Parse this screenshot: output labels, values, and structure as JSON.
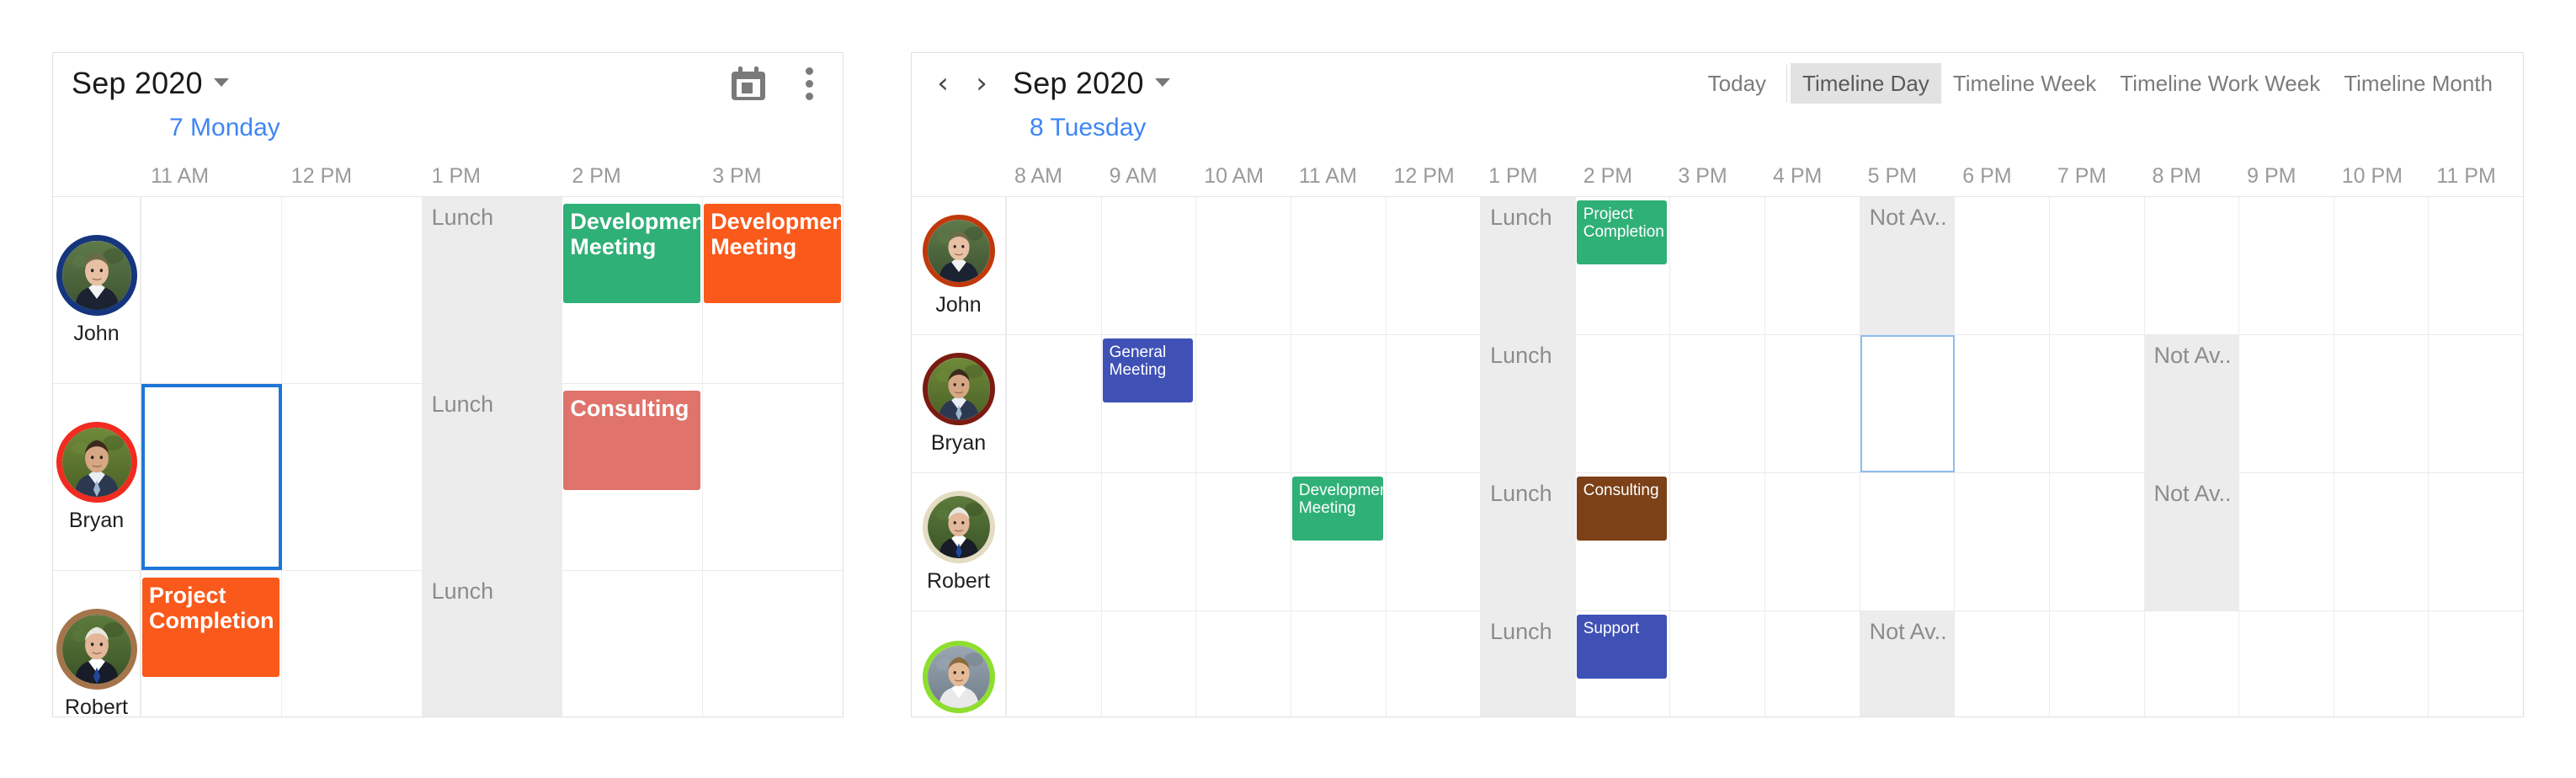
{
  "colors": {
    "accent_blue": "#3f86f4",
    "selection_strong": "#1e76d6",
    "selection_light": "#8ebdf0",
    "green": "#2fb077",
    "orange": "#f9591b",
    "salmon": "#e0736b",
    "indigo": "#3f51b5",
    "brown": "#7c4117",
    "nonworking_gray": "#ececec",
    "grid_line": "#eaeaea"
  },
  "left_scheduler": {
    "name": "day-view-scheduler",
    "toolbar": {
      "title": "Sep 2020",
      "calendar_icon": "calendar-icon",
      "menu_icon": "kebab-menu-icon"
    },
    "day_label": "7 Monday",
    "time_ticks": [
      "11 AM",
      "12 PM",
      "1 PM",
      "2 PM",
      "3 PM"
    ],
    "resources": [
      {
        "name": "John",
        "ring_color": "#15357e",
        "face": "john"
      },
      {
        "name": "Bryan",
        "ring_color": "#f02b20",
        "face": "bryan"
      },
      {
        "name": "Robert",
        "ring_color": "#a5744a",
        "face": "robert"
      }
    ],
    "lunch_label": "Lunch",
    "appointments": [
      {
        "resource": "John",
        "subject": "Development Meeting",
        "color": "#2fb077",
        "start": "2 PM",
        "span": 1
      },
      {
        "resource": "John",
        "subject": "Development Meeting",
        "color": "#f9591b",
        "start": "3 PM",
        "span": 1
      },
      {
        "resource": "Bryan",
        "subject": "Consulting",
        "color": "#e0736b",
        "start": "2 PM",
        "span": 1
      },
      {
        "resource": "Robert",
        "subject": "Project Completion",
        "color": "#f9591b",
        "start": "11 AM",
        "span": 1
      }
    ],
    "selected_cell": {
      "resource": "Bryan",
      "time": "11 AM"
    }
  },
  "right_scheduler": {
    "name": "timeline-day-scheduler",
    "toolbar": {
      "prev_label": "‹",
      "next_label": "›",
      "title": "Sep 2020",
      "today_label": "Today",
      "views": [
        {
          "label": "Timeline Day",
          "active": true
        },
        {
          "label": "Timeline Week",
          "active": false
        },
        {
          "label": "Timeline Work Week",
          "active": false
        },
        {
          "label": "Timeline Month",
          "active": false
        }
      ]
    },
    "day_label": "8 Tuesday",
    "time_ticks": [
      "8 AM",
      "9 AM",
      "10 AM",
      "11 AM",
      "12 PM",
      "1 PM",
      "2 PM",
      "3 PM",
      "4 PM",
      "5 PM",
      "6 PM",
      "7 PM",
      "8 PM",
      "9 PM",
      "10 PM",
      "11 PM"
    ],
    "resources": [
      {
        "name": "John",
        "ring_color": "#c0390b",
        "face": "john"
      },
      {
        "name": "Bryan",
        "ring_color": "#7a1b12",
        "face": "bryan"
      },
      {
        "name": "Robert",
        "ring_color": "#e4dcc2",
        "face": "robert"
      },
      {
        "name": "",
        "ring_color": "#8ede2e",
        "face": "fourth"
      }
    ],
    "lunch_label": "Lunch",
    "not_available_label": "Not Av..",
    "appointments": [
      {
        "resource": "John",
        "subject": "Project Completion",
        "color": "#2fb077",
        "start": "2 PM"
      },
      {
        "resource": "Bryan",
        "subject": "General Meeting",
        "color": "#3f51b5",
        "start": "9 AM"
      },
      {
        "resource": "Robert",
        "subject": "Development Meeting",
        "color": "#2fb077",
        "start": "11 AM"
      },
      {
        "resource": "Robert",
        "subject": "Consulting",
        "color": "#7c4117",
        "start": "2 PM"
      },
      {
        "resource": "",
        "subject": "Support",
        "color": "#3f51b5",
        "start": "2 PM"
      }
    ],
    "not_available_cells": [
      {
        "resource": "John",
        "time": "5 PM"
      },
      {
        "resource": "Bryan",
        "time": "8 PM"
      },
      {
        "resource": "Robert",
        "time": "8 PM"
      },
      {
        "resource": "",
        "time": "5 PM"
      }
    ],
    "selected_cell": {
      "resource": "Bryan",
      "time": "5 PM"
    }
  }
}
